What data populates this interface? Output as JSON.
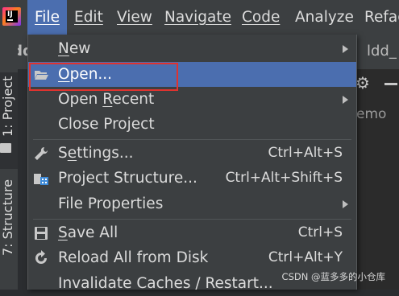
{
  "menubar": {
    "app_icon": "intellij-logo-icon",
    "logo_text": "IJ",
    "items": [
      {
        "label": "File",
        "mnemonic_index": 0
      },
      {
        "label": "Edit",
        "mnemonic_index": 0
      },
      {
        "label": "View",
        "mnemonic_index": 0
      },
      {
        "label": "Navigate",
        "mnemonic_index": 0
      },
      {
        "label": "Code",
        "mnemonic_index": 0
      },
      {
        "label": "Analyze",
        "mnemonic_index": 0
      },
      {
        "label": "Refac",
        "mnemonic_index": -1
      }
    ]
  },
  "background": {
    "project_label": "ldd",
    "editor_tab_label": "ldd_",
    "hint_text": "emo",
    "left_tabs": [
      "1: Project",
      "7: Structure"
    ]
  },
  "file_menu": {
    "items": [
      {
        "label": "New",
        "underline": "N",
        "shortcut": "",
        "submenu": true,
        "icon": ""
      },
      {
        "label": "Open...",
        "underline": "O",
        "shortcut": "",
        "submenu": false,
        "icon": "folder-open-icon",
        "highlighted": true
      },
      {
        "label": "Open Recent",
        "underline": "R",
        "shortcut": "",
        "submenu": true,
        "icon": ""
      },
      {
        "label": "Close Project",
        "underline": "",
        "shortcut": "",
        "submenu": false,
        "icon": ""
      },
      {
        "label": "Settings...",
        "underline": "t",
        "shortcut": "Ctrl+Alt+S",
        "submenu": false,
        "icon": "wrench-icon"
      },
      {
        "label": "Project Structure...",
        "underline": "",
        "shortcut": "Ctrl+Alt+Shift+S",
        "submenu": false,
        "icon": "project-structure-icon"
      },
      {
        "label": "File Properties",
        "underline": "",
        "shortcut": "",
        "submenu": true,
        "icon": ""
      },
      {
        "label": "Save All",
        "underline": "S",
        "shortcut": "Ctrl+S",
        "submenu": false,
        "icon": "save-icon"
      },
      {
        "label": "Reload All from Disk",
        "underline": "",
        "shortcut": "Ctrl+Alt+Y",
        "submenu": false,
        "icon": "reload-icon"
      },
      {
        "label": "Invalidate Caches / Restart...",
        "underline": "",
        "shortcut": "",
        "submenu": false,
        "icon": ""
      }
    ]
  },
  "watermark": "CSDN @蓝多多的小仓库",
  "colors": {
    "menubar_bg": "#3c3f41",
    "highlight": "#4b6eaf",
    "annotation_red": "#e0332f",
    "text": "#dcdcdc"
  }
}
